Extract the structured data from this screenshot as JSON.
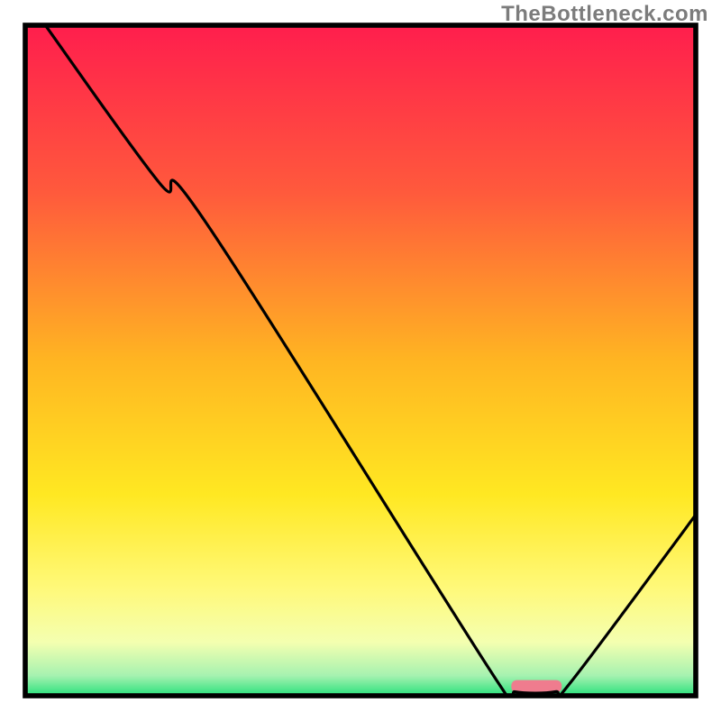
{
  "watermark": "TheBottleneck.com",
  "chart_data": {
    "type": "line",
    "title": "",
    "xlabel": "",
    "ylabel": "",
    "xlim": [
      0,
      100
    ],
    "ylim": [
      0,
      100
    ],
    "gradient_stops": [
      {
        "offset": 0,
        "color": "#ff1e4d"
      },
      {
        "offset": 25,
        "color": "#ff5a3c"
      },
      {
        "offset": 50,
        "color": "#ffb522"
      },
      {
        "offset": 70,
        "color": "#ffe822"
      },
      {
        "offset": 84,
        "color": "#fff97a"
      },
      {
        "offset": 92,
        "color": "#f4ffb0"
      },
      {
        "offset": 97,
        "color": "#a6f2b0"
      },
      {
        "offset": 100,
        "color": "#29e07c"
      }
    ],
    "series": [
      {
        "name": "bottleneck-curve",
        "points": [
          {
            "x": 3.0,
            "y": 100.0
          },
          {
            "x": 20.0,
            "y": 76.5
          },
          {
            "x": 27.0,
            "y": 70.5
          },
          {
            "x": 70.5,
            "y": 2.0
          },
          {
            "x": 73.0,
            "y": 0.6
          },
          {
            "x": 79.0,
            "y": 0.6
          },
          {
            "x": 81.5,
            "y": 2.2
          },
          {
            "x": 100.0,
            "y": 27.0
          }
        ]
      }
    ],
    "marker": {
      "name": "optimal-range",
      "x0": 72.5,
      "x1": 80.0,
      "y": 1.4,
      "color": "#ef7c8e"
    },
    "frame": {
      "x": 3.5,
      "y": 3.5,
      "w": 93.0,
      "h": 93.0,
      "stroke": "#000000",
      "stroke_width": 0.7
    }
  }
}
